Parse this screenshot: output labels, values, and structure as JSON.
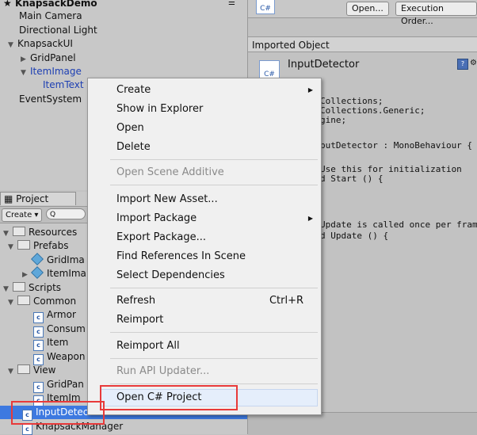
{
  "hierarchy": {
    "root": "KnapsackDemo",
    "items": [
      "Main Camera",
      "Directional Light",
      "KnapsackUI",
      "GridPanel",
      "ItemImage",
      "ItemText",
      "EventSystem"
    ]
  },
  "project": {
    "tab": "Project",
    "create_label": "Create",
    "search_placeholder": "Q",
    "tree": [
      "Resources",
      "Prefabs",
      "GridIma",
      "ItemIma",
      "Scripts",
      "Common",
      "Armor",
      "Consum",
      "Item",
      "Weapon",
      "View",
      "GridPan",
      "ItemIm",
      "InputDetector",
      "KnapsackManager"
    ]
  },
  "inspector": {
    "open_btn": "Open...",
    "exec_btn": "Execution Order...",
    "section": "Imported Object",
    "object_name": "InputDetector",
    "code_lines": [
      "Collections;",
      "Collections.Generic;",
      "gine;",
      "",
      "putDetector : MonoBehaviour {",
      "",
      "Use this for initialization",
      "d Start () {",
      "",
      "",
      "",
      "Update is called once per frame",
      "d Update () {"
    ]
  },
  "context_menu": {
    "items": [
      {
        "label": "Create"
      },
      {
        "label": "Show in Explorer"
      },
      {
        "label": "Open"
      },
      {
        "label": "Delete"
      },
      {
        "label": "Open Scene Additive"
      },
      {
        "label": "Import New Asset..."
      },
      {
        "label": "Import Package"
      },
      {
        "label": "Export Package..."
      },
      {
        "label": "Find References In Scene"
      },
      {
        "label": "Select Dependencies"
      },
      {
        "label": "Refresh",
        "shortcut": "Ctrl+R"
      },
      {
        "label": "Reimport"
      },
      {
        "label": "Reimport All"
      },
      {
        "label": "Run API Updater..."
      },
      {
        "label": "Open C# Project"
      }
    ]
  },
  "colors": {
    "selection": "#3d79e0",
    "highlight_box": "#e83a3a"
  }
}
